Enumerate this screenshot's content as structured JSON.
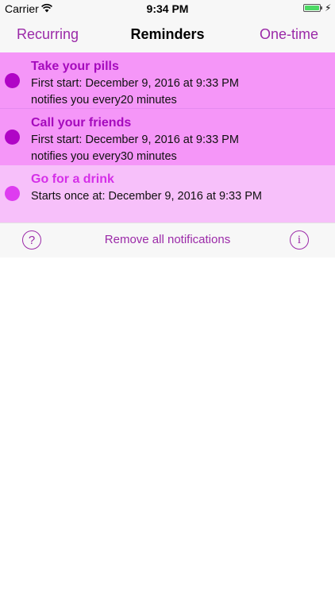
{
  "status_bar": {
    "carrier": "Carrier",
    "time": "9:34 PM",
    "battery_color": "#4cd964"
  },
  "nav": {
    "left_label": "Recurring",
    "title": "Reminders",
    "right_label": "One-time",
    "accent_color": "#9b2aa8"
  },
  "reminders": [
    {
      "title": "Take your pills",
      "line1": "First start: December 9, 2016 at 9:33 PM",
      "line2": "notifies you every20 minutes",
      "kind": "recurring"
    },
    {
      "title": "Call your friends",
      "line1": "First start: December 9, 2016 at 9:33 PM",
      "line2": "notifies you every30 minutes",
      "kind": "recurring"
    },
    {
      "title": "Go for a drink",
      "line1": "Starts once at: December 9, 2016 at 9:33 PM",
      "kind": "one-time"
    }
  ],
  "toolbar": {
    "help_label": "?",
    "remove_label": "Remove all notifications",
    "info_label": "i"
  },
  "icons": {
    "wifi": "wifi-icon",
    "battery": "battery-icon",
    "charging": "charging-bolt-icon",
    "help": "question-circle-icon",
    "info": "info-circle-icon"
  }
}
